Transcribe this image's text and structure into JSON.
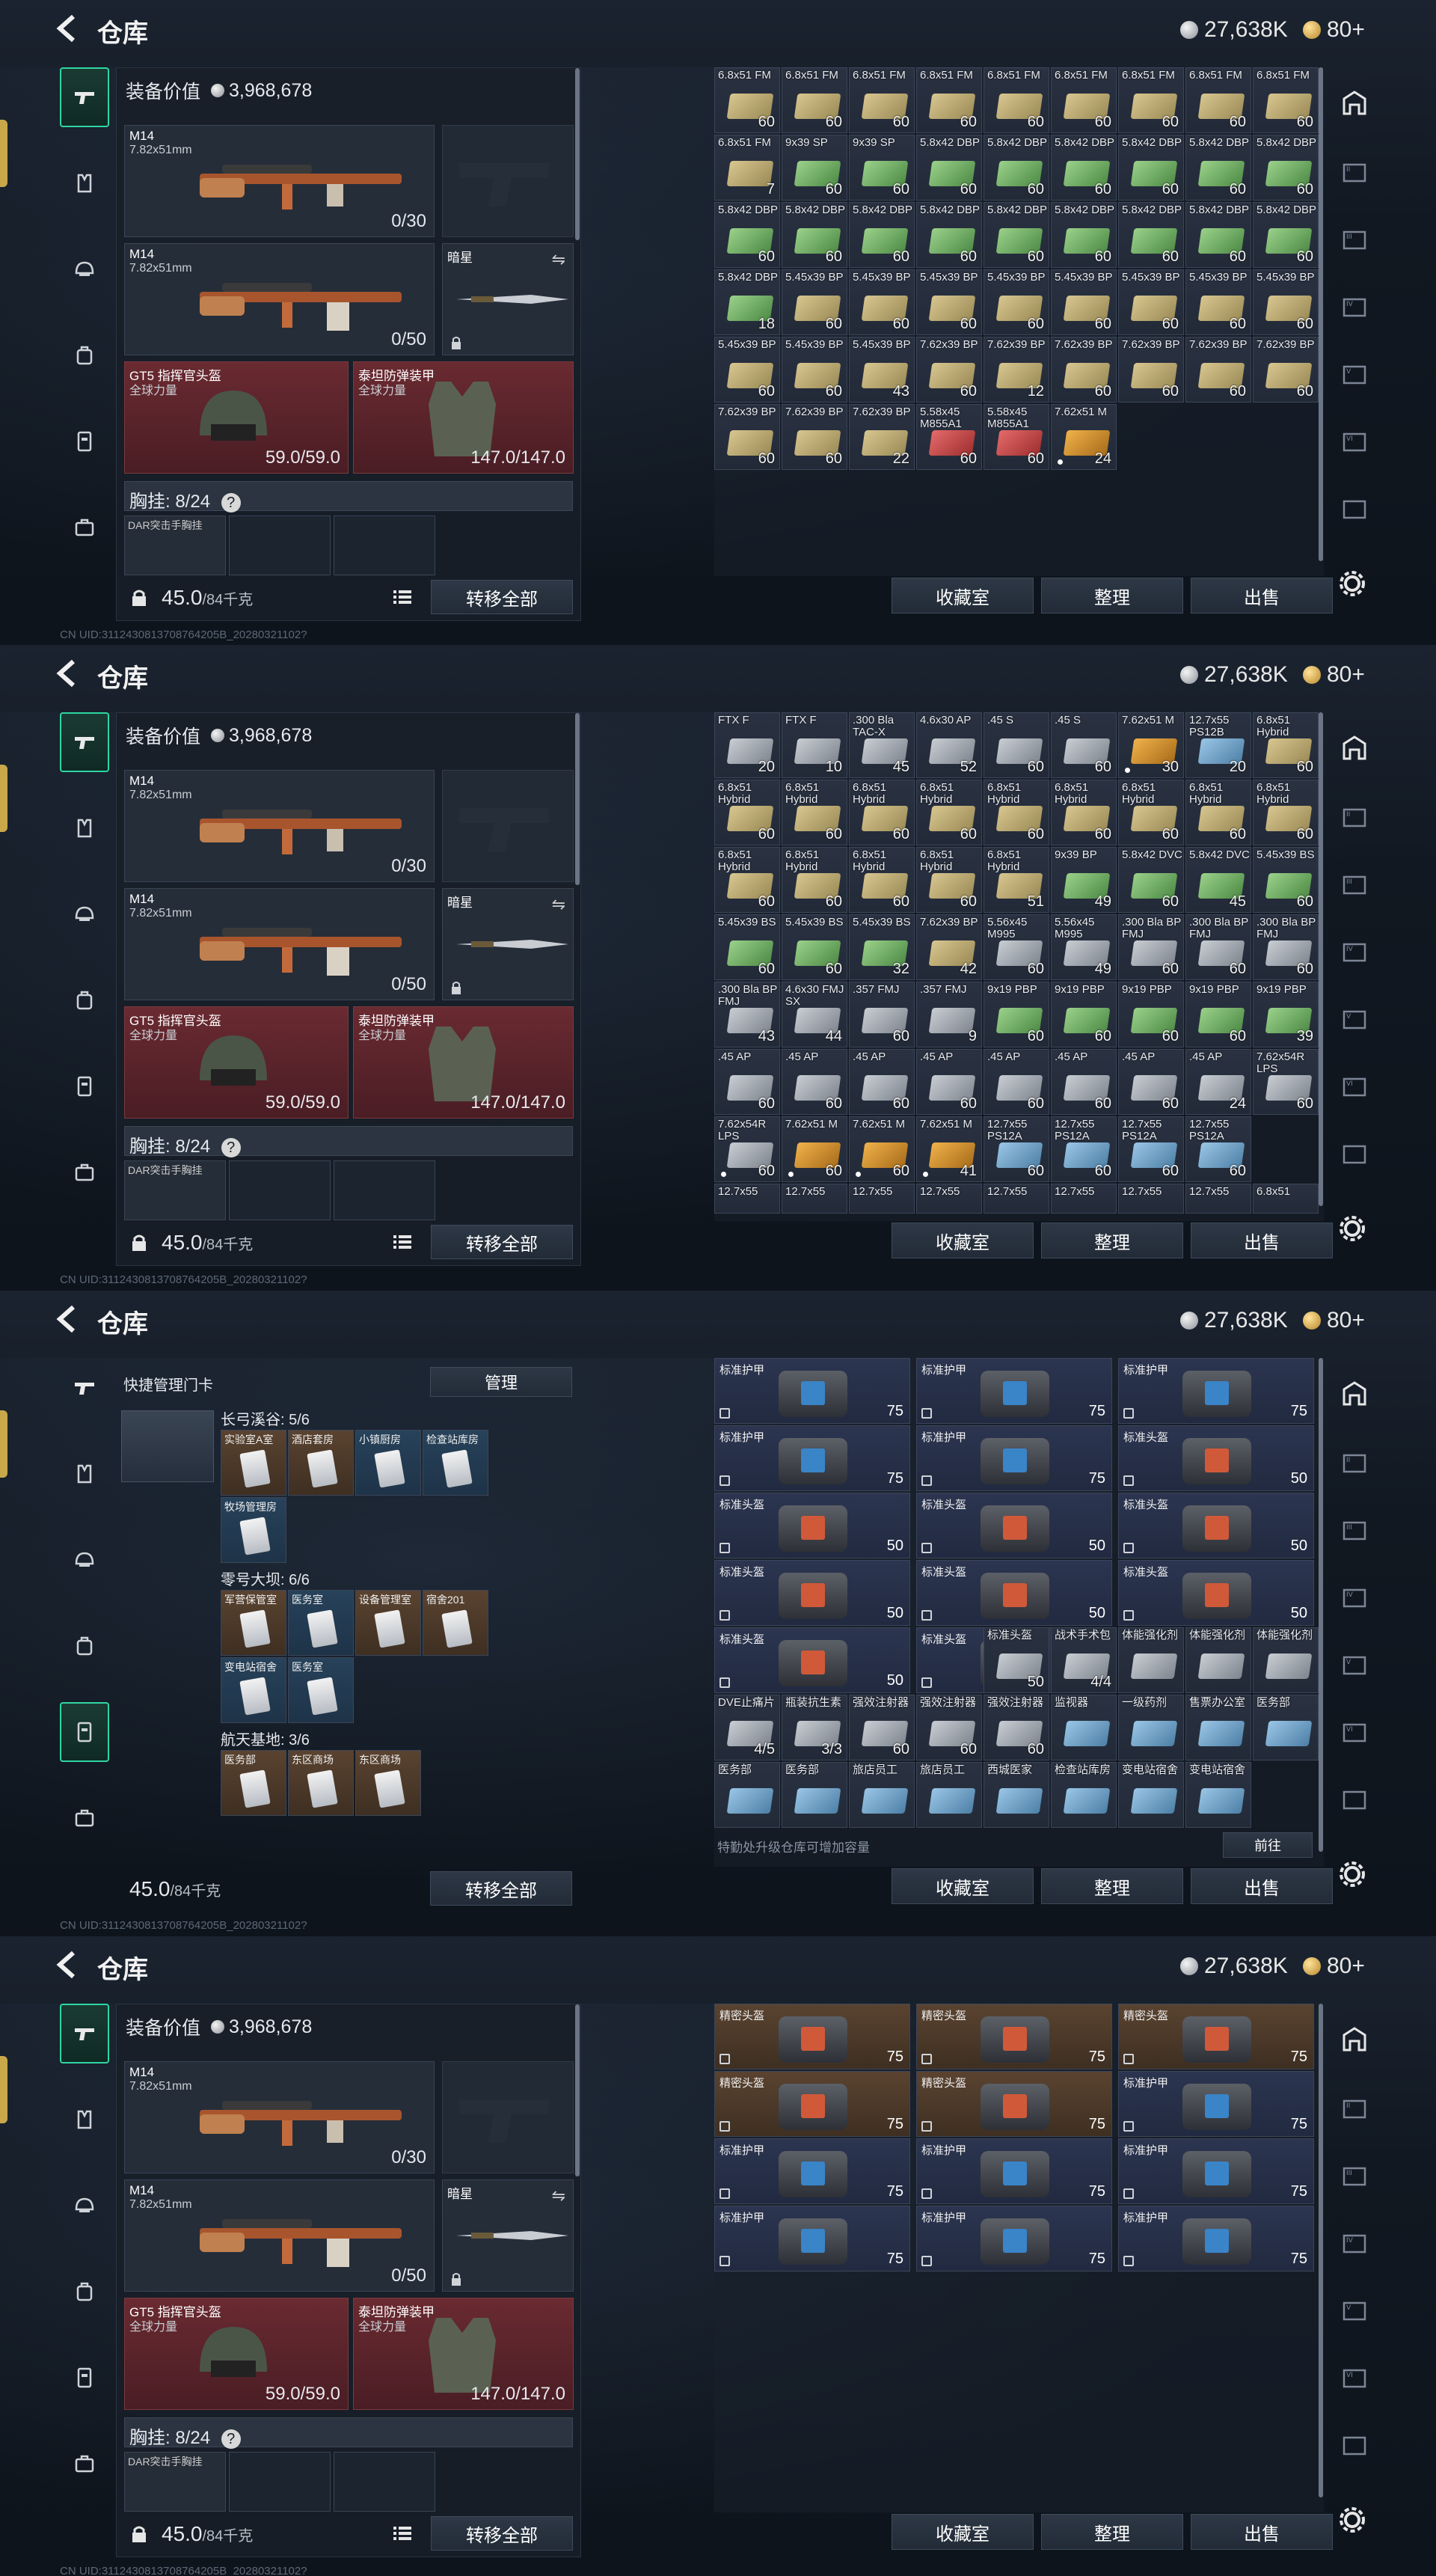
{
  "common": {
    "title": "仓库",
    "silver": "27,638K",
    "gold": "80+",
    "equip_value_label": "装备价值",
    "equip_value": "3,968,678",
    "weapon1": {
      "name": "M14",
      "caliber": "7.82x51mm",
      "ammo": "0/30"
    },
    "weapon2": {
      "name": "M14",
      "caliber": "7.82x51mm",
      "ammo": "0/50"
    },
    "melee": "暗星",
    "helmet": {
      "name": "GT5 指挥官头盔",
      "sub": "全球力量",
      "dur": "59.0/59.0"
    },
    "armor": {
      "name": "泰坦防弹装甲",
      "sub": "全球力量",
      "dur": "147.0/147.0"
    },
    "chest_label": "胸挂: 8/24",
    "chest_item": "DAR突击手胸挂",
    "weight": "45.0",
    "weight_unit": "/84千克",
    "transfer_all": "转移全部",
    "btn_collection": "收藏室",
    "btn_sort": "整理",
    "btn_sell": "出售",
    "uid": "CN UID:3112430813708764205B_20280321102?"
  },
  "panel1_items": [
    {
      "l": "6.8x51 FM",
      "c": "60",
      "t": "yellow"
    },
    {
      "l": "6.8x51 FM",
      "c": "60",
      "t": "yellow"
    },
    {
      "l": "6.8x51 FM",
      "c": "60",
      "t": "yellow"
    },
    {
      "l": "6.8x51 FM",
      "c": "60",
      "t": "yellow"
    },
    {
      "l": "6.8x51 FM",
      "c": "60",
      "t": "yellow"
    },
    {
      "l": "6.8x51 FM",
      "c": "60",
      "t": "yellow"
    },
    {
      "l": "6.8x51 FM",
      "c": "60",
      "t": "yellow"
    },
    {
      "l": "6.8x51 FM",
      "c": "60",
      "t": "yellow"
    },
    {
      "l": "6.8x51 FM",
      "c": "60",
      "t": "yellow"
    },
    {
      "l": "6.8x51 FM",
      "c": "7",
      "t": "yellow"
    },
    {
      "l": "9x39 SP",
      "c": "60",
      "t": "green"
    },
    {
      "l": "9x39 SP",
      "c": "60",
      "t": "green"
    },
    {
      "l": "5.8x42 DBP",
      "c": "60",
      "t": "green"
    },
    {
      "l": "5.8x42 DBP",
      "c": "60",
      "t": "green"
    },
    {
      "l": "5.8x42 DBP",
      "c": "60",
      "t": "green"
    },
    {
      "l": "5.8x42 DBP",
      "c": "60",
      "t": "green"
    },
    {
      "l": "5.8x42 DBP",
      "c": "60",
      "t": "green"
    },
    {
      "l": "5.8x42 DBP",
      "c": "60",
      "t": "green"
    },
    {
      "l": "5.8x42 DBP",
      "c": "60",
      "t": "green"
    },
    {
      "l": "5.8x42 DBP",
      "c": "60",
      "t": "green"
    },
    {
      "l": "5.8x42 DBP",
      "c": "60",
      "t": "green"
    },
    {
      "l": "5.8x42 DBP",
      "c": "60",
      "t": "green"
    },
    {
      "l": "5.8x42 DBP",
      "c": "60",
      "t": "green"
    },
    {
      "l": "5.8x42 DBP",
      "c": "60",
      "t": "green"
    },
    {
      "l": "5.8x42 DBP",
      "c": "60",
      "t": "green"
    },
    {
      "l": "5.8x42 DBP",
      "c": "60",
      "t": "green"
    },
    {
      "l": "5.8x42 DBP",
      "c": "60",
      "t": "green"
    },
    {
      "l": "5.8x42 DBP",
      "c": "18",
      "t": "green"
    },
    {
      "l": "5.45x39 BP",
      "c": "60",
      "t": "yellow"
    },
    {
      "l": "5.45x39 BP",
      "c": "60",
      "t": "yellow"
    },
    {
      "l": "5.45x39 BP",
      "c": "60",
      "t": "yellow"
    },
    {
      "l": "5.45x39 BP",
      "c": "60",
      "t": "yellow"
    },
    {
      "l": "5.45x39 BP",
      "c": "60",
      "t": "yellow"
    },
    {
      "l": "5.45x39 BP",
      "c": "60",
      "t": "yellow"
    },
    {
      "l": "5.45x39 BP",
      "c": "60",
      "t": "yellow"
    },
    {
      "l": "5.45x39 BP",
      "c": "60",
      "t": "yellow"
    },
    {
      "l": "5.45x39 BP",
      "c": "60",
      "t": "yellow"
    },
    {
      "l": "5.45x39 BP",
      "c": "60",
      "t": "yellow"
    },
    {
      "l": "5.45x39 BP",
      "c": "43",
      "t": "yellow"
    },
    {
      "l": "7.62x39 BP",
      "c": "60",
      "t": "yellow"
    },
    {
      "l": "7.62x39 BP",
      "c": "12",
      "t": "yellow"
    },
    {
      "l": "7.62x39 BP",
      "c": "60",
      "t": "yellow"
    },
    {
      "l": "7.62x39 BP",
      "c": "60",
      "t": "yellow"
    },
    {
      "l": "7.62x39 BP",
      "c": "60",
      "t": "yellow"
    },
    {
      "l": "7.62x39 BP",
      "c": "60",
      "t": "yellow"
    },
    {
      "l": "7.62x39 BP",
      "c": "60",
      "t": "yellow"
    },
    {
      "l": "7.62x39 BP",
      "c": "60",
      "t": "yellow"
    },
    {
      "l": "7.62x39 BP",
      "c": "22",
      "t": "yellow"
    },
    {
      "l": "5.58x45 M855A1",
      "c": "60",
      "t": "red"
    },
    {
      "l": "5.58x45 M855A1",
      "c": "60",
      "t": "red"
    },
    {
      "l": "7.62x51 M",
      "c": "24",
      "t": "orange",
      "dot": true
    }
  ],
  "panel2_items": [
    {
      "l": "FTX F",
      "c": "20",
      "t": "gray"
    },
    {
      "l": "FTX F",
      "c": "10",
      "t": "gray"
    },
    {
      "l": ".300 Bla TAC-X",
      "c": "45",
      "t": "gray"
    },
    {
      "l": "4.6x30 AP",
      "c": "52",
      "t": "gray"
    },
    {
      "l": ".45 S",
      "c": "60",
      "t": "gray"
    },
    {
      "l": ".45 S",
      "c": "60",
      "t": "gray"
    },
    {
      "l": "7.62x51 M",
      "c": "30",
      "t": "orange",
      "dot": true
    },
    {
      "l": "12.7x55 PS12B",
      "c": "20",
      "t": "blue"
    },
    {
      "l": "6.8x51 Hybrid",
      "c": "60",
      "t": "yellow"
    },
    {
      "l": "6.8x51 Hybrid",
      "c": "60",
      "t": "yellow"
    },
    {
      "l": "6.8x51 Hybrid",
      "c": "60",
      "t": "yellow"
    },
    {
      "l": "6.8x51 Hybrid",
      "c": "60",
      "t": "yellow"
    },
    {
      "l": "6.8x51 Hybrid",
      "c": "60",
      "t": "yellow"
    },
    {
      "l": "6.8x51 Hybrid",
      "c": "60",
      "t": "yellow"
    },
    {
      "l": "6.8x51 Hybrid",
      "c": "60",
      "t": "yellow"
    },
    {
      "l": "6.8x51 Hybrid",
      "c": "60",
      "t": "yellow"
    },
    {
      "l": "6.8x51 Hybrid",
      "c": "60",
      "t": "yellow"
    },
    {
      "l": "6.8x51 Hybrid",
      "c": "60",
      "t": "yellow"
    },
    {
      "l": "6.8x51 Hybrid",
      "c": "60",
      "t": "yellow"
    },
    {
      "l": "6.8x51 Hybrid",
      "c": "60",
      "t": "yellow"
    },
    {
      "l": "6.8x51 Hybrid",
      "c": "60",
      "t": "yellow"
    },
    {
      "l": "6.8x51 Hybrid",
      "c": "60",
      "t": "yellow"
    },
    {
      "l": "6.8x51 Hybrid",
      "c": "51",
      "t": "yellow"
    },
    {
      "l": "9x39 BP",
      "c": "49",
      "t": "green"
    },
    {
      "l": "5.8x42 DVC",
      "c": "60",
      "t": "green"
    },
    {
      "l": "5.8x42 DVC",
      "c": "45",
      "t": "green"
    },
    {
      "l": "5.45x39 BS",
      "c": "60",
      "t": "green"
    },
    {
      "l": "5.45x39 BS",
      "c": "60",
      "t": "green"
    },
    {
      "l": "5.45x39 BS",
      "c": "60",
      "t": "green"
    },
    {
      "l": "5.45x39 BS",
      "c": "32",
      "t": "green"
    },
    {
      "l": "7.62x39 BP",
      "c": "42",
      "t": "yellow"
    },
    {
      "l": "5.56x45 M995",
      "c": "60",
      "t": "gray"
    },
    {
      "l": "5.56x45 M995",
      "c": "49",
      "t": "gray"
    },
    {
      "l": ".300 Bla BP FMJ",
      "c": "60",
      "t": "gray"
    },
    {
      "l": ".300 Bla BP FMJ",
      "c": "60",
      "t": "gray"
    },
    {
      "l": ".300 Bla BP FMJ",
      "c": "60",
      "t": "gray"
    },
    {
      "l": ".300 Bla BP FMJ",
      "c": "43",
      "t": "gray"
    },
    {
      "l": "4.6x30 FMJ SX",
      "c": "44",
      "t": "gray"
    },
    {
      "l": ".357 FMJ",
      "c": "60",
      "t": "gray"
    },
    {
      "l": ".357 FMJ",
      "c": "9",
      "t": "gray"
    },
    {
      "l": "9x19 PBP",
      "c": "60",
      "t": "green"
    },
    {
      "l": "9x19 PBP",
      "c": "60",
      "t": "green"
    },
    {
      "l": "9x19 PBP",
      "c": "60",
      "t": "green"
    },
    {
      "l": "9x19 PBP",
      "c": "60",
      "t": "green"
    },
    {
      "l": "9x19 PBP",
      "c": "39",
      "t": "green"
    },
    {
      "l": ".45 AP",
      "c": "60",
      "t": "gray"
    },
    {
      "l": ".45 AP",
      "c": "60",
      "t": "gray"
    },
    {
      "l": ".45 AP",
      "c": "60",
      "t": "gray"
    },
    {
      "l": ".45 AP",
      "c": "60",
      "t": "gray"
    },
    {
      "l": ".45 AP",
      "c": "60",
      "t": "gray"
    },
    {
      "l": ".45 AP",
      "c": "60",
      "t": "gray"
    },
    {
      "l": ".45 AP",
      "c": "60",
      "t": "gray"
    },
    {
      "l": ".45 AP",
      "c": "24",
      "t": "gray"
    },
    {
      "l": "7.62x54R LPS",
      "c": "60",
      "t": "gray"
    },
    {
      "l": "7.62x54R LPS",
      "c": "60",
      "t": "gray",
      "dot": true
    },
    {
      "l": "7.62x51 M",
      "c": "60",
      "t": "orange",
      "dot": true
    },
    {
      "l": "7.62x51 M",
      "c": "60",
      "t": "orange",
      "dot": true
    },
    {
      "l": "7.62x51 M",
      "c": "41",
      "t": "orange",
      "dot": true
    },
    {
      "l": "12.7x55 PS12A",
      "c": "60",
      "t": "blue"
    },
    {
      "l": "12.7x55 PS12A",
      "c": "60",
      "t": "blue"
    },
    {
      "l": "12.7x55 PS12A",
      "c": "60",
      "t": "blue"
    },
    {
      "l": "12.7x55 PS12A",
      "c": "60",
      "t": "blue"
    }
  ],
  "panel2_tail": [
    "12.7x55",
    "12.7x55",
    "12.7x55",
    "12.7x55",
    "12.7x55",
    "12.7x55",
    "12.7x55",
    "12.7x55",
    "6.8x51"
  ],
  "panel3": {
    "keys_title": "快捷管理门卡",
    "manage": "管理",
    "groups": [
      {
        "name": "长弓溪谷: 5/6",
        "cards": [
          {
            "l": "实验室A室",
            "t": "brown"
          },
          {
            "l": "酒店套房",
            "t": "brown"
          },
          {
            "l": "小镇厨房",
            "t": "blue"
          },
          {
            "l": "检查站库房",
            "t": "blue"
          },
          {
            "l": "牧场管理房",
            "t": "blue"
          }
        ]
      },
      {
        "name": "零号大坝: 6/6",
        "cards": [
          {
            "l": "军营保管室",
            "t": "brown"
          },
          {
            "l": "医务室",
            "t": "blue"
          },
          {
            "l": "设备管理室",
            "t": "brown"
          },
          {
            "l": "宿舍201",
            "t": "brown"
          },
          {
            "l": "变电站宿舍",
            "t": "blue"
          },
          {
            "l": "医务室",
            "t": "blue"
          }
        ]
      },
      {
        "name": "航天基地: 3/6",
        "cards": [
          {
            "l": "医务部",
            "t": "brown"
          },
          {
            "l": "东区商场",
            "t": "brown"
          },
          {
            "l": "东区商场",
            "t": "brown"
          }
        ]
      }
    ],
    "row_armor": [
      {
        "l": "标准护甲",
        "v": "75",
        "a": "blue"
      },
      {
        "l": "标准护甲",
        "v": "75",
        "a": "blue"
      },
      {
        "l": "标准护甲",
        "v": "75",
        "a": "blue"
      },
      {
        "l": "标准护甲",
        "v": "75",
        "a": "blue"
      },
      {
        "l": "标准护甲",
        "v": "75",
        "a": "blue"
      },
      {
        "l": "标准头盔",
        "v": "50",
        "a": "orange"
      }
    ],
    "row_helm": [
      {
        "l": "标准头盔",
        "v": "50",
        "a": "orange"
      },
      {
        "l": "标准头盔",
        "v": "50",
        "a": "orange"
      },
      {
        "l": "标准头盔",
        "v": "50",
        "a": "orange"
      },
      {
        "l": "标准头盔",
        "v": "50",
        "a": "orange"
      },
      {
        "l": "标准头盔",
        "v": "50",
        "a": "orange"
      },
      {
        "l": "标准头盔",
        "v": "50",
        "a": "orange"
      },
      {
        "l": "标准头盔",
        "v": "50",
        "a": "orange"
      },
      {
        "l": "标准头盔",
        "v": "50",
        "a": "orange"
      }
    ],
    "small_items": [
      {
        "l": "标准头盔",
        "c": "50"
      },
      {
        "l": "战术手术包",
        "c": "4/4"
      },
      {
        "l": "体能强化剂",
        "c": ""
      },
      {
        "l": "体能强化剂",
        "c": ""
      },
      {
        "l": "体能强化剂",
        "c": ""
      },
      {
        "l": "DVE止痛片",
        "c": "4/5"
      },
      {
        "l": "瓶装抗生素",
        "c": "3/3"
      },
      {
        "l": "强效注射器",
        "c": "60"
      },
      {
        "l": "强效注射器",
        "c": "60"
      },
      {
        "l": "强效注射器",
        "c": "60"
      },
      {
        "l": "监视器",
        "c": ""
      },
      {
        "l": "一级药剂",
        "c": ""
      },
      {
        "l": "售票办公室",
        "c": ""
      },
      {
        "l": "医务部",
        "c": ""
      },
      {
        "l": "医务部",
        "c": ""
      },
      {
        "l": "医务部",
        "c": ""
      },
      {
        "l": "旅店员工",
        "c": ""
      },
      {
        "l": "旅店员工",
        "c": ""
      },
      {
        "l": "西城医家",
        "c": ""
      },
      {
        "l": "检查站库房",
        "c": ""
      },
      {
        "l": "变电站宿舍",
        "c": ""
      },
      {
        "l": "变电站宿舍",
        "c": ""
      }
    ],
    "hint": "特勤处升级仓库可增加容量",
    "goto": "前往"
  },
  "panel4": {
    "bigs": [
      {
        "l": "精密头盔",
        "v": "75",
        "t": "brown",
        "a": "orange"
      },
      {
        "l": "精密头盔",
        "v": "75",
        "t": "brown",
        "a": "orange"
      },
      {
        "l": "精密头盔",
        "v": "75",
        "t": "brown",
        "a": "orange"
      },
      {
        "l": "精密头盔",
        "v": "75",
        "t": "brown",
        "a": "orange"
      },
      {
        "l": "精密头盔",
        "v": "75",
        "t": "brown",
        "a": "orange"
      },
      {
        "l": "标准护甲",
        "v": "75",
        "t": "navy",
        "a": "blue"
      },
      {
        "l": "标准护甲",
        "v": "75",
        "t": "navy",
        "a": "blue"
      },
      {
        "l": "标准护甲",
        "v": "75",
        "t": "navy",
        "a": "blue"
      },
      {
        "l": "标准护甲",
        "v": "75",
        "t": "navy",
        "a": "blue"
      },
      {
        "l": "标准护甲",
        "v": "75",
        "t": "navy",
        "a": "blue"
      },
      {
        "l": "标准护甲",
        "v": "75",
        "t": "navy",
        "a": "blue"
      },
      {
        "l": "标准护甲",
        "v": "75",
        "t": "navy",
        "a": "blue"
      }
    ]
  }
}
